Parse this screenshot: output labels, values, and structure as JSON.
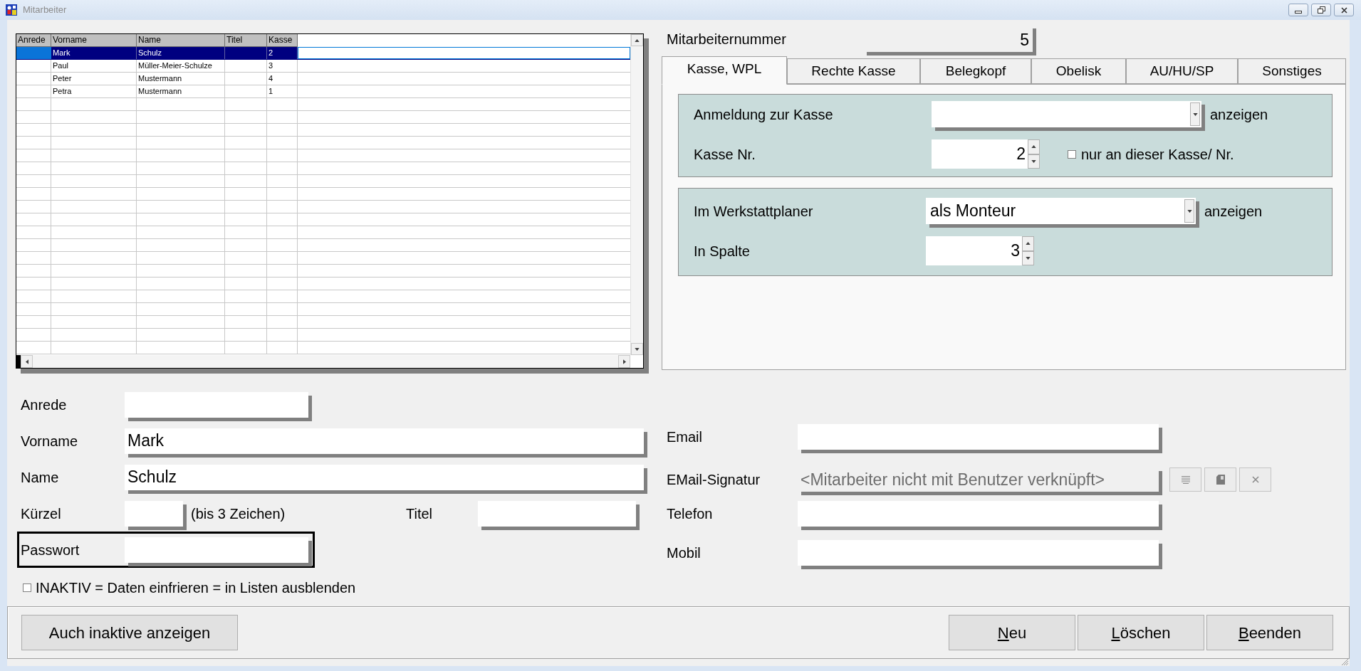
{
  "window": {
    "title": "Mitarbeiter"
  },
  "table": {
    "columns": [
      "Anrede",
      "Vorname",
      "Name",
      "Titel",
      "Kasse"
    ],
    "rows": [
      {
        "vorname": "Mark",
        "name": "Schulz",
        "kasse": "2",
        "selected": true
      },
      {
        "vorname": "Paul",
        "name": "Müller-Meier-Schulze",
        "kasse": "3",
        "selected": false
      },
      {
        "vorname": "Peter",
        "name": "Mustermann",
        "kasse": "4",
        "selected": false
      },
      {
        "vorname": "Petra",
        "name": "Mustermann",
        "kasse": "1",
        "selected": false
      }
    ]
  },
  "employee_number": {
    "label": "Mitarbeiternummer",
    "value": "5"
  },
  "tabs": [
    {
      "label": "Kasse, WPL",
      "selected": true
    },
    {
      "label": "Rechte Kasse",
      "selected": false
    },
    {
      "label": "Belegkopf",
      "selected": false
    },
    {
      "label": "Obelisk",
      "selected": false
    },
    {
      "label": "AU/HU/SP",
      "selected": false
    },
    {
      "label": "Sonstiges",
      "selected": false
    }
  ],
  "groups": [
    {
      "rows": [
        {
          "kind": "dropdown",
          "label": "Anmeldung zur Kasse",
          "suffix": "anzeigen"
        },
        {
          "kind": "spinner",
          "label": "Kasse Nr.",
          "value": "2",
          "checkbox": {
            "label": "nur an dieser Kasse/ Nr.",
            "checked": false
          }
        }
      ]
    },
    {
      "rows": [
        {
          "kind": "dropdown",
          "label": "Im Werkstattplaner",
          "value": "als Monteur",
          "suffix": "anzeigen"
        },
        {
          "kind": "spinner",
          "label": "In Spalte",
          "value": "3"
        }
      ]
    }
  ],
  "person_fields": [
    {
      "kind": "short",
      "label": "Anrede",
      "focused": false
    },
    {
      "kind": "wide",
      "label": "Vorname",
      "value": "Mark",
      "focused": false
    },
    {
      "kind": "wide",
      "label": "Name",
      "value": "Schulz",
      "focused": false
    },
    {
      "kind": "initials",
      "label": "Kürzel",
      "hint": "(bis 3 Zeichen)",
      "second_label": "Titel",
      "focused": false
    },
    {
      "kind": "short",
      "label": "Passwort",
      "focused": true
    }
  ],
  "inactive": {
    "label": "INAKTIV = Daten einfrieren = in Listen ausblenden",
    "checked": false
  },
  "contact_fields": [
    {
      "kind": "text",
      "label": "Email",
      "disabled": false
    },
    {
      "kind": "linked",
      "label": "EMail-Signatur",
      "value": "<Mitarbeiter nicht mit Benutzer verknüpft>",
      "disabled": true
    },
    {
      "kind": "text",
      "label": "Telefon",
      "disabled": false
    },
    {
      "kind": "text",
      "label": "Mobil",
      "disabled": false
    }
  ],
  "footer": {
    "left": [
      {
        "label": "Auch inaktive anzeigen",
        "mnemonic": false
      }
    ],
    "right": [
      {
        "label": "Neu",
        "mnemonic": true
      },
      {
        "label": "Löschen",
        "mnemonic": true
      },
      {
        "label": "Beenden",
        "mnemonic": true
      }
    ]
  }
}
